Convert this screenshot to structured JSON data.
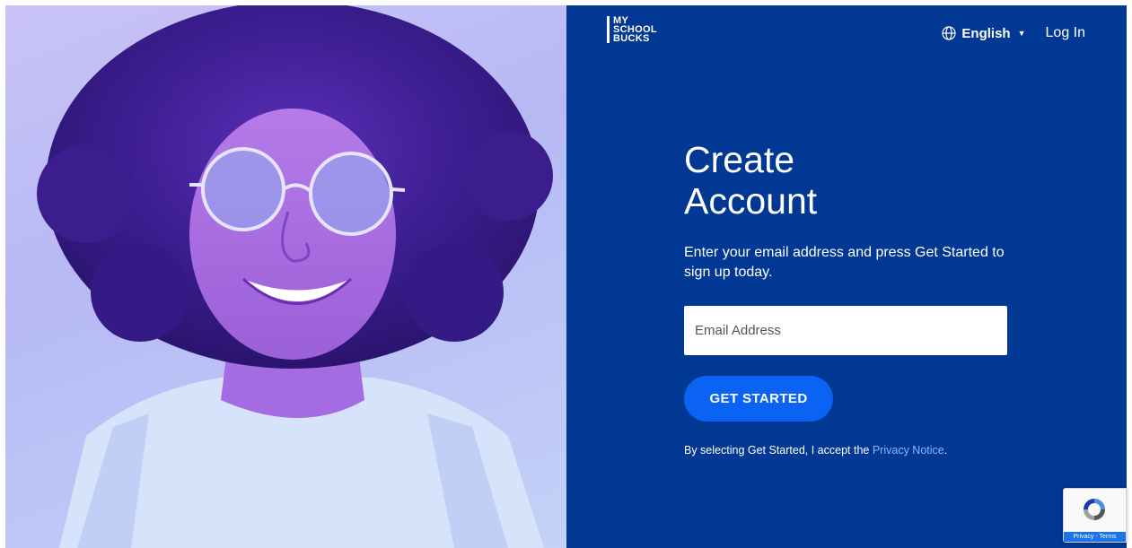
{
  "brand": {
    "logo_line1": "MY",
    "logo_line2": "SCHOOL",
    "logo_line3": "BUCKS"
  },
  "nav": {
    "language": "English",
    "login": "Log In"
  },
  "signup": {
    "title_line1": "Create",
    "title_line2": "Account",
    "subtitle": "Enter your email address and press Get Started to sign up today.",
    "email_placeholder": "Email Address",
    "cta": "GET STARTED",
    "consent_prefix": "By selecting Get Started, I accept the ",
    "consent_link": "Privacy Notice",
    "consent_suffix": "."
  },
  "recaptcha": {
    "footer": "Privacy - Terms"
  },
  "colors": {
    "panel": "#003893",
    "cta": "#0a63f2",
    "link": "#8fb5ff"
  }
}
